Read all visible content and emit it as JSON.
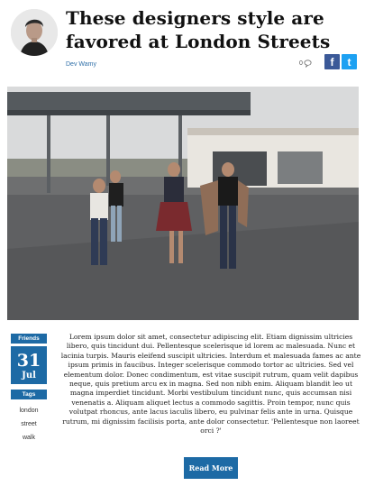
{
  "post": {
    "title": "These designers style are favored at London Streets",
    "author": "Dev Wamy",
    "comment_count": "0"
  },
  "share": {
    "facebook": "f",
    "twitter": "t"
  },
  "sidebar": {
    "friends_label": "Friends",
    "date_day": "31",
    "date_month": "Jul",
    "tags_label": "Tags",
    "tags": [
      "london",
      "street",
      "walk"
    ]
  },
  "body": "Lorem ipsum dolor sit amet, consectetur adipiscing elit. Etiam dignissim ultricies libero, quis tincidunt dui. Pellentesque scelerisque id lorem ac malesuada. Nunc et lacinia turpis. Mauris eleifend suscipit ultricies. Interdum et malesuada fames ac ante ipsum primis in faucibus. Integer scelerisque commodo tortor ac ultricies. Sed vel elementum dolor. Donec condimentum, est vitae suscipit rutrum, quam velit dapibus neque, quis pretium arcu ex in magna. Sed non nibh enim. Aliquam blandit leo ut magna imperdiet tincidunt. Morbi vestibulum tincidunt nunc, quis accumsan nisi venenatis a. Aliquam aliquet lectus a commodo sagittis. Proin tempor, nunc quis volutpat rhoncus, ante lacus iaculis libero, eu pulvinar felis ante in urna. Quisque rutrum, mi dignissim facilisis porta, ante dolor consectetur. 'Pellentesque non laoreet orci ?'",
  "read_more_label": "Read More",
  "colors": {
    "accent": "#1d6aa5",
    "facebook": "#3b5998",
    "twitter": "#1da1f2",
    "author_link": "#2f6fa8"
  },
  "icons": {
    "comment": "comment-icon",
    "facebook": "facebook-icon",
    "twitter": "twitter-icon"
  }
}
